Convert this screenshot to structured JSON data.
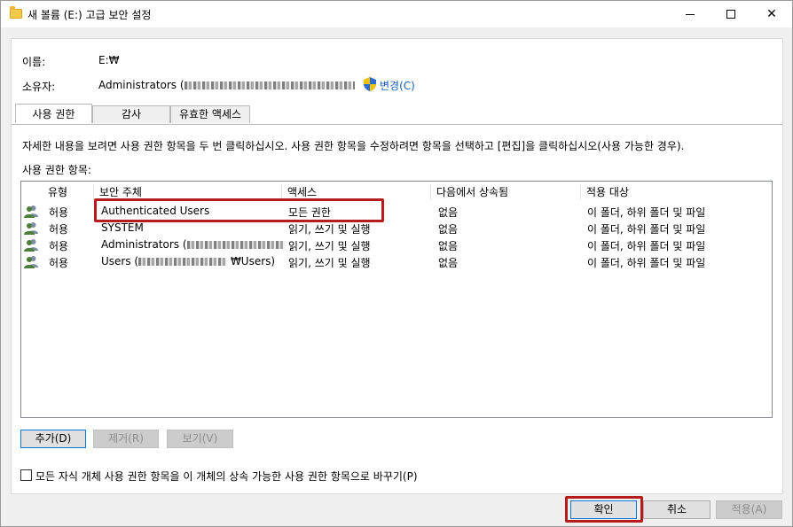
{
  "window": {
    "title": "새 볼륨 (E:) 고급 보안 설정",
    "minimize_label": "—",
    "close_label": "✕"
  },
  "fields": {
    "name_label": "이름:",
    "name_value": "E:₩",
    "owner_label": "소유자:",
    "owner_value": "Administrators (",
    "change_link": "변경(C)"
  },
  "tabs": [
    {
      "label": "사용 권한"
    },
    {
      "label": "감사"
    },
    {
      "label": "유효한 액세스"
    }
  ],
  "hint": "자세한 내용을 보려면 사용 권한 항목을 두 번 클릭하십시오. 사용 권한 항목을 수정하려면 항목을 선택하고 [편집]을 클릭하십시오(사용 가능한 경우).",
  "entries_label": "사용 권한 항목:",
  "columns": [
    "유형",
    "보안 주체",
    "액세스",
    "다음에서 상속됨",
    "적용 대상"
  ],
  "rows": [
    {
      "type": "허용",
      "principal": "Authenticated Users",
      "access": "모든 권한",
      "inherited": "없음",
      "applies": "이 폴더, 하위 폴더 및 파일"
    },
    {
      "type": "허용",
      "principal": "SYSTEM",
      "access": "읽기, 쓰기 및 실행",
      "inherited": "없음",
      "applies": "이 폴더, 하위 폴더 및 파일"
    },
    {
      "type": "허용",
      "principal": "Administrators (",
      "access": "읽기, 쓰기 및 실행",
      "inherited": "없음",
      "applies": "이 폴더, 하위 폴더 및 파일"
    },
    {
      "type": "허용",
      "principal": "Users (",
      "principal_suffix": "₩Users)",
      "access": "읽기, 쓰기 및 실행",
      "inherited": "없음",
      "applies": "이 폴더, 하위 폴더 및 파일"
    }
  ],
  "buttons": {
    "add": "추가(D)",
    "remove": "제거(R)",
    "view": "보기(V)",
    "ok": "확인",
    "cancel": "취소",
    "apply": "적용(A)"
  },
  "checkbox_label": "모든 자식 개체 사용 권한 항목을 이 개체의 상속 가능한 사용 권한 항목으로 바꾸기(P)",
  "colors": {
    "highlight_box": "#b71c1c",
    "link": "#1a5fb4",
    "folder_icon": "#f5c94a"
  },
  "icons": {
    "title": "folder-icon",
    "change": "uac-shield-icon",
    "principal": "user-group-icon"
  }
}
